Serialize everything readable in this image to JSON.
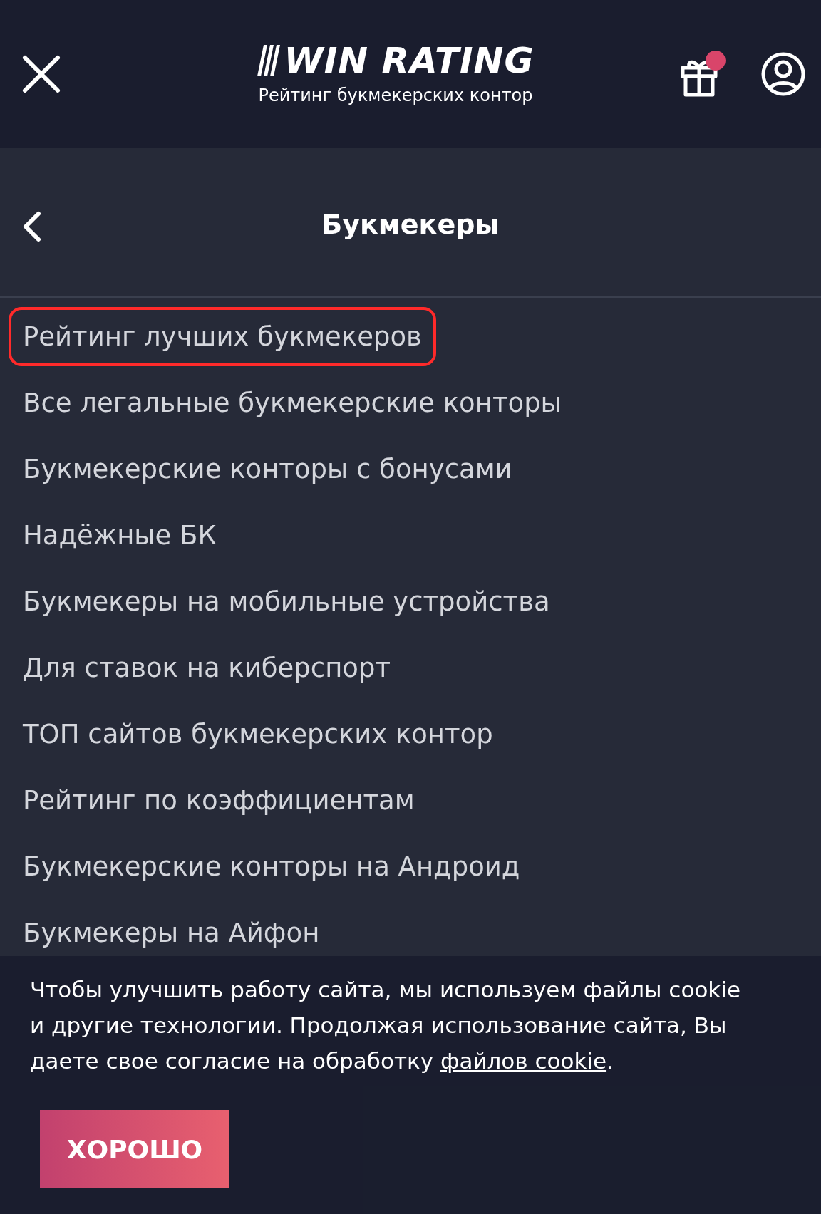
{
  "header": {
    "logo": "WIN RATING",
    "tagline": "Рейтинг букмекерских контор",
    "gift_notification": true
  },
  "menu": {
    "title": "Букмекеры",
    "items": [
      {
        "label": "Рейтинг лучших букмекеров",
        "selected": true
      },
      {
        "label": "Все легальные букмекерские конторы",
        "selected": false
      },
      {
        "label": "Букмекерские конторы с бонусами",
        "selected": false
      },
      {
        "label": "Надёжные БК",
        "selected": false
      },
      {
        "label": "Букмекеры на мобильные устройства",
        "selected": false
      },
      {
        "label": "Для ставок на киберспорт",
        "selected": false
      },
      {
        "label": "ТОП сайтов букмекерских контор",
        "selected": false
      },
      {
        "label": "Рейтинг по коэффициентам",
        "selected": false
      },
      {
        "label": "Букмекерские конторы на Андроид",
        "selected": false
      },
      {
        "label": "Букмекеры на Айфон",
        "selected": false
      }
    ]
  },
  "cookie_banner": {
    "text": "Чтобы улучшить работу сайта, мы используем файлы cookie и другие технологии. Продолжая использование сайта, Вы даете свое согласие на обработку ",
    "link": "файлов cookie",
    "after": ".",
    "button": "ХОРОШО"
  }
}
